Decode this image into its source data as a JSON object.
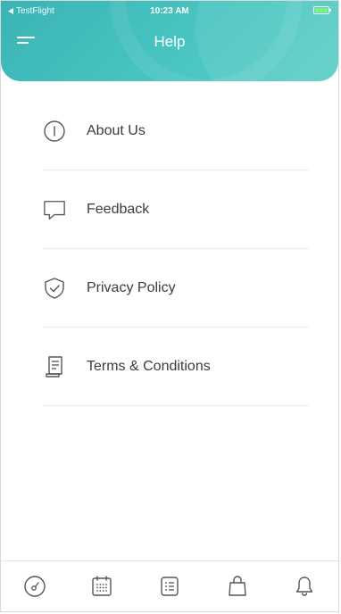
{
  "status_bar": {
    "back_app": "TestFlight",
    "time": "10:23 AM"
  },
  "header": {
    "title": "Help",
    "menu_icon": "hamburger-menu-icon"
  },
  "colors": {
    "header_accent": "#45c2bf",
    "icon_stroke": "#555555",
    "divider": "#ededed"
  },
  "help_items": [
    {
      "label": "About Us",
      "icon": "info-circle-icon"
    },
    {
      "label": "Feedback",
      "icon": "chat-bubble-icon"
    },
    {
      "label": "Privacy Policy",
      "icon": "shield-check-icon"
    },
    {
      "label": "Terms & Conditions",
      "icon": "document-scroll-icon"
    }
  ],
  "tabbar": [
    {
      "icon": "speedometer-icon"
    },
    {
      "icon": "calendar-icon"
    },
    {
      "icon": "checklist-icon"
    },
    {
      "icon": "shopping-bag-icon"
    },
    {
      "icon": "bell-icon"
    }
  ]
}
